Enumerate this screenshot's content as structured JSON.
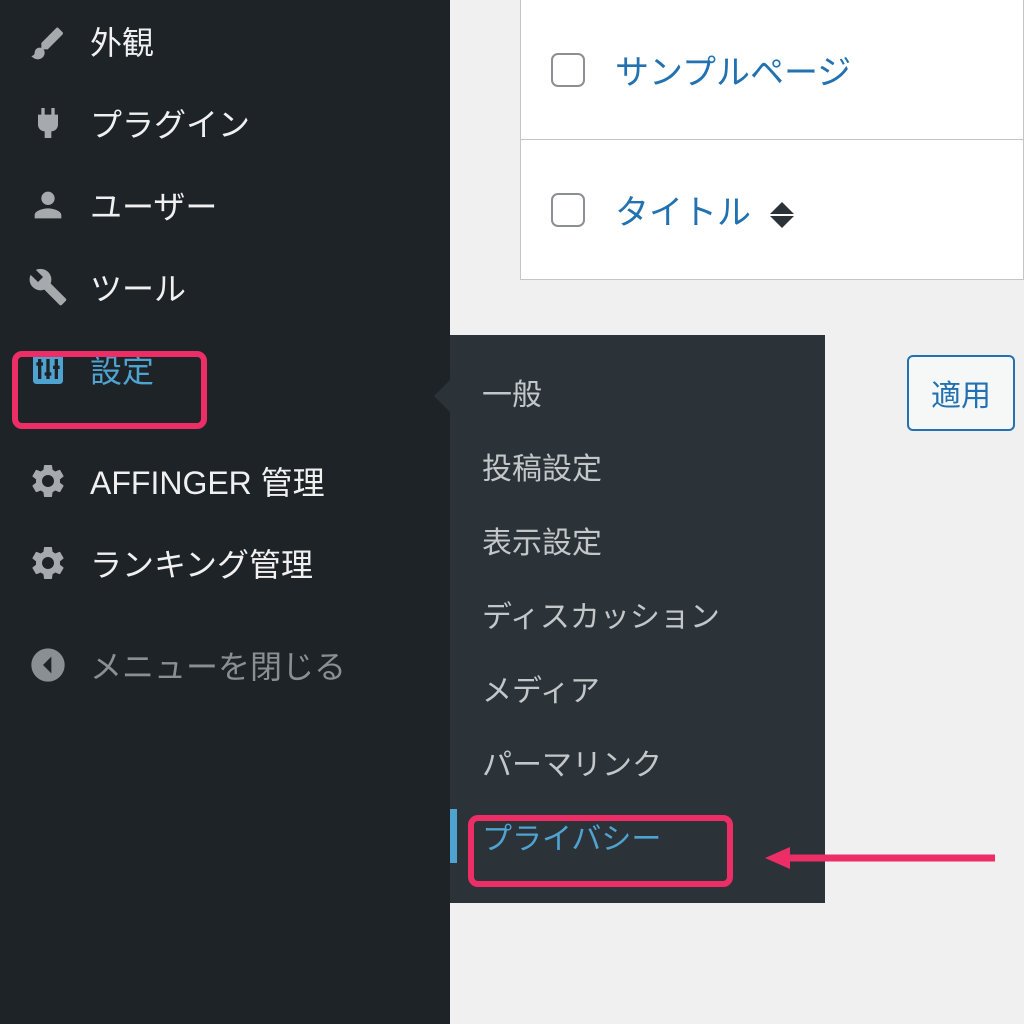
{
  "sidebar": {
    "items": [
      {
        "label": "外観"
      },
      {
        "label": "プラグイン"
      },
      {
        "label": "ユーザー"
      },
      {
        "label": "ツール"
      },
      {
        "label": "設定"
      },
      {
        "label": "AFFINGER 管理"
      },
      {
        "label": "ランキング管理"
      },
      {
        "label": "メニューを閉じる"
      }
    ]
  },
  "submenu": {
    "items": [
      {
        "label": "一般"
      },
      {
        "label": "投稿設定"
      },
      {
        "label": "表示設定"
      },
      {
        "label": "ディスカッション"
      },
      {
        "label": "メディア"
      },
      {
        "label": "パーマリンク"
      },
      {
        "label": "プライバシー"
      }
    ]
  },
  "main": {
    "row1_link": "サンプルページ",
    "header_title": "タイトル",
    "apply_label": "適用"
  }
}
